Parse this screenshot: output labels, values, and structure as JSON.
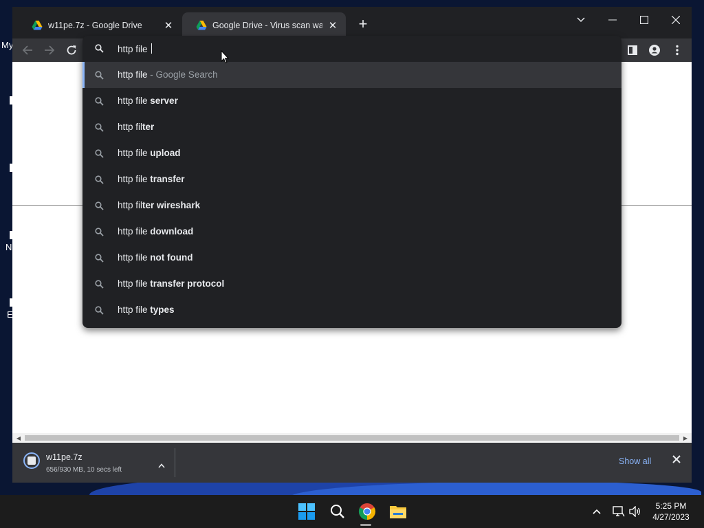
{
  "desktop": {
    "icon_fragments": [
      "My",
      "N",
      "E"
    ]
  },
  "tabs": [
    {
      "title": "w11pe.7z - Google Drive",
      "active": false,
      "icon": "google-drive-icon"
    },
    {
      "title": "Google Drive - Virus scan warning",
      "active": true,
      "icon": "google-drive-icon"
    }
  ],
  "toolbar": {
    "back_icon": "back-arrow-icon",
    "forward_icon": "forward-arrow-icon",
    "reload_icon": "reload-icon"
  },
  "omnibox": {
    "query": "http file ",
    "suggestions": [
      {
        "typed": "http file",
        "completion": "",
        "suffix": " - Google Search",
        "selected": true
      },
      {
        "typed": "http file ",
        "completion": "server",
        "suffix": ""
      },
      {
        "typed": "http fil",
        "completion": "ter",
        "suffix": ""
      },
      {
        "typed": "http file ",
        "completion": "upload",
        "suffix": ""
      },
      {
        "typed": "http file ",
        "completion": "transfer",
        "suffix": ""
      },
      {
        "typed": "http fil",
        "completion": "ter wireshark",
        "suffix": ""
      },
      {
        "typed": "http file ",
        "completion": "download",
        "suffix": ""
      },
      {
        "typed": "http file ",
        "completion": "not found",
        "suffix": ""
      },
      {
        "typed": "http file ",
        "completion": "transfer protocol",
        "suffix": ""
      },
      {
        "typed": "http file ",
        "completion": "types",
        "suffix": ""
      }
    ]
  },
  "download": {
    "filename": "w11pe.7z",
    "status": "656/930 MB, 10 secs left",
    "show_all_label": "Show all"
  },
  "clock": {
    "time": "5:25 PM",
    "date": "4/27/2023"
  },
  "colors": {
    "accent": "#8ab4f8",
    "chrome_dark": "#202124",
    "toolbar": "#35363a"
  }
}
